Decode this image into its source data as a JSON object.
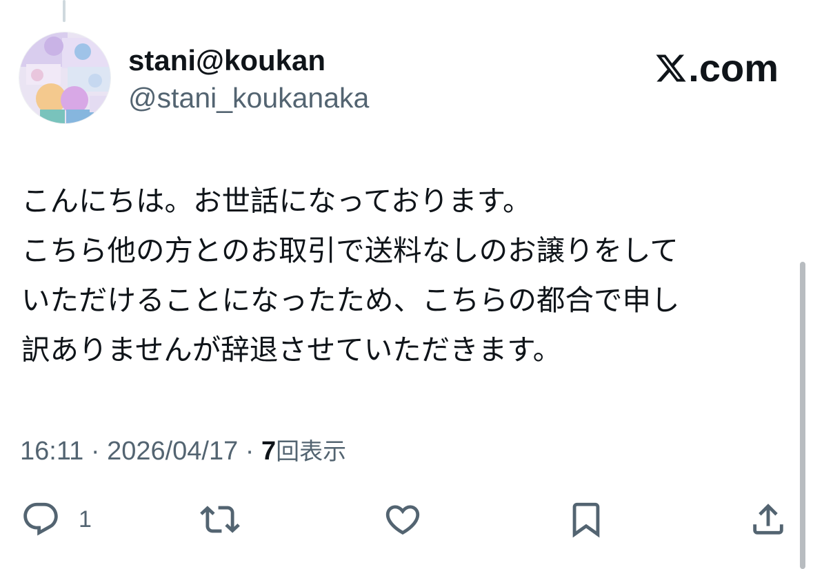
{
  "user": {
    "display_name": "stani@koukan",
    "handle": "@stani_koukanaka"
  },
  "brand": {
    "text": ".com",
    "icon": "x-logo-icon"
  },
  "tweet": {
    "lines": [
      "こんにちは。お世話になっております。",
      "こちら他の方とのお取引で送料なしのお譲りをして",
      "いただけることになったため、こちらの都合で申し",
      "訳ありませんが辞退させていただきます。"
    ]
  },
  "meta": {
    "time": "16:11",
    "separator": " · ",
    "date": "2026/04/17",
    "views_count": "7",
    "views_label": "回表示"
  },
  "actions": {
    "reply": {
      "icon": "reply-icon",
      "count": "1"
    },
    "repost": {
      "icon": "repost-icon",
      "count": ""
    },
    "like": {
      "icon": "heart-icon",
      "count": ""
    },
    "bookmark": {
      "icon": "bookmark-icon",
      "count": ""
    },
    "share": {
      "icon": "share-icon",
      "count": ""
    }
  },
  "colors": {
    "text_primary": "#0f1419",
    "text_secondary": "#536471",
    "icon": "#536471",
    "thread_line": "#cfd9de"
  }
}
